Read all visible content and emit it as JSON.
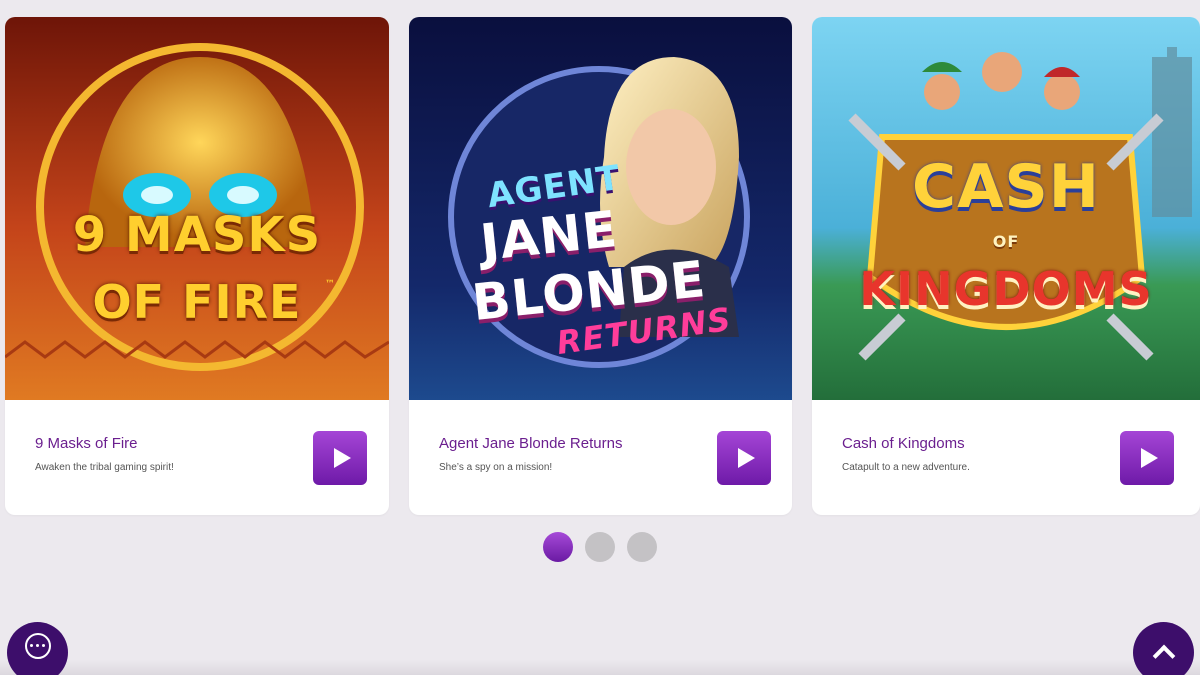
{
  "games": [
    {
      "name": "9 Masks of Fire",
      "description": "Awaken the tribal gaming spirit!",
      "art_title_line1": "9 MASKS",
      "art_title_line2": "OF FIRE",
      "trademark": "™",
      "colors": {
        "bg_top": "#7a1c0c",
        "bg_bottom": "#d9641a",
        "title": "#ffcf2e"
      }
    },
    {
      "name": "Agent Jane Blonde Returns",
      "description": "She’s a spy on a mission!",
      "art_title_line1": "AGENT",
      "art_title_line2": "JANE",
      "art_title_line3": "BLONDE",
      "art_title_line4": "RETURNS",
      "colors": {
        "bg_top": "#0d1450",
        "bg_bottom": "#1b3f8a",
        "title": "#ffffff",
        "accent": "#ff3d9a"
      }
    },
    {
      "name": "Cash of Kingdoms",
      "description": "Catapult to a new adventure.",
      "art_title_line1": "CASH",
      "art_title_line2": "OF",
      "art_title_line3": "KINGDOMS",
      "colors": {
        "bg_top": "#5fc1e8",
        "bg_bottom": "#2f8a4a",
        "title": "#ffd23a",
        "accent": "#e8352c"
      }
    }
  ],
  "pagination": {
    "pages": 3,
    "active_index": 0
  },
  "icons": {
    "play": "play-icon",
    "chat": "chat-bubble-icon",
    "scroll_top": "chevron-up-icon"
  },
  "theme": {
    "brand_purple": "#6e1aa8",
    "dark_purple": "#3d0e6b",
    "page_bg": "#ece9ee"
  }
}
